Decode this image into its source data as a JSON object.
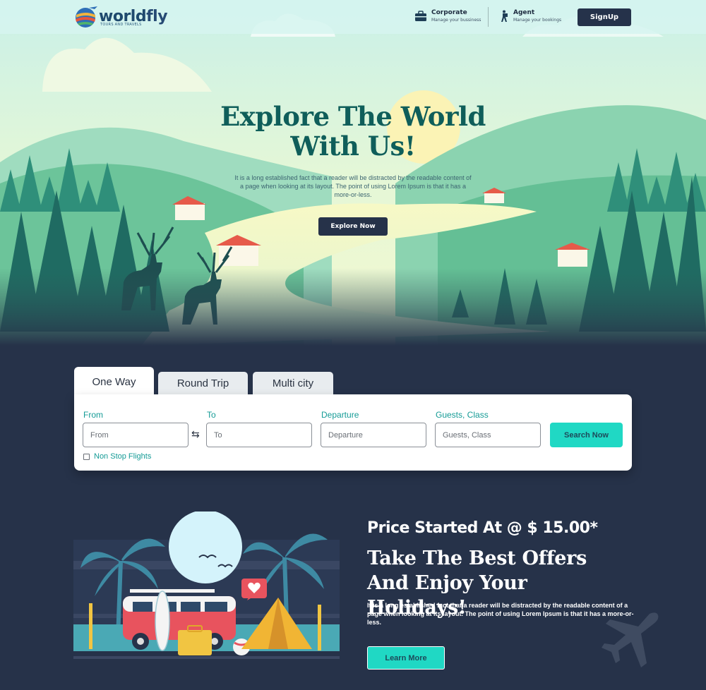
{
  "header": {
    "logo_name_a": "world",
    "logo_name_b": "fly",
    "logo_tagline": "TOURS AND TRAVELS",
    "corporate": {
      "title": "Corporate",
      "subtitle": "Manage your bussiness",
      "icon": "briefcase-icon"
    },
    "agent": {
      "title": "Agent",
      "subtitle": "Manage your bookings",
      "icon": "hiker-icon"
    },
    "signup_label": "SignUp"
  },
  "hero": {
    "title_line1": "Explore The World",
    "title_line2": "With Us!",
    "text": "It is a long established fact that a reader will be distracted by the readable content of a page when looking at its layout. The point of using Lorem Ipsum is that it has a more-or-less.",
    "button_label": "Explore Now"
  },
  "search": {
    "tabs": [
      {
        "label": "One Way",
        "active": true
      },
      {
        "label": "Round Trip",
        "active": false
      },
      {
        "label": "Multi city",
        "active": false
      }
    ],
    "fields": {
      "from": {
        "label": "From",
        "placeholder": "From"
      },
      "to": {
        "label": "To",
        "placeholder": "To"
      },
      "departure": {
        "label": "Departure",
        "placeholder": "Departure"
      },
      "guests": {
        "label": "Guests, Class",
        "placeholder": "Guests, Class"
      }
    },
    "swap_icon": "⇆",
    "search_label": "Search Now",
    "nonstop_label": "Non Stop Flights",
    "nonstop_checked": false
  },
  "offer": {
    "price_line": "Price Started At @ $ 15.00*",
    "title": "Take The Best Offers And Enjoy Your Holidays!",
    "text": "It is a long established fact that a reader will be distracted by the readable content of a page when looking at its layout. The point of using Lorem Ipsum is that it has a more-or-less.",
    "button_label": "Learn More"
  },
  "colors": {
    "navy": "#263249",
    "teal": "#20d8c4",
    "label_teal": "#159b96",
    "title_green": "#0f5e5a"
  }
}
